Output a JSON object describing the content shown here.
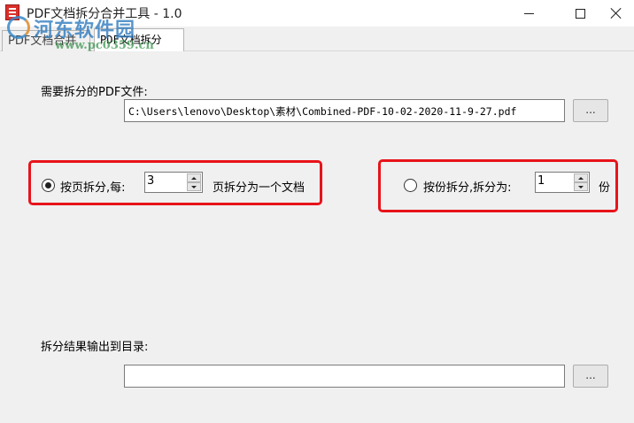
{
  "window": {
    "title": "PDF文档拆分合并工具 - 1.0"
  },
  "watermark": {
    "site_name": "河东软件园",
    "url": "www.pc0359.cn"
  },
  "tabs": [
    {
      "label": "PDF文档合并",
      "selected": false
    },
    {
      "label": "PDF文档拆分",
      "selected": true
    }
  ],
  "source": {
    "label": "需要拆分的PDF文件:",
    "path": "C:\\Users\\lenovo\\Desktop\\素材\\Combined-PDF-10-02-2020-11-9-27.pdf",
    "browse_label": "..."
  },
  "split_by_page": {
    "selected": true,
    "prefix": "按页拆分,每:",
    "value": "3",
    "suffix": "页拆分为一个文档"
  },
  "split_by_copies": {
    "selected": false,
    "prefix": "按份拆分,拆分为:",
    "value": "1",
    "suffix": "份"
  },
  "output": {
    "label": "拆分结果输出到目录:",
    "path": "",
    "browse_label": "..."
  },
  "colors": {
    "highlight": "#e8131a",
    "background": "#f0f0f0"
  }
}
